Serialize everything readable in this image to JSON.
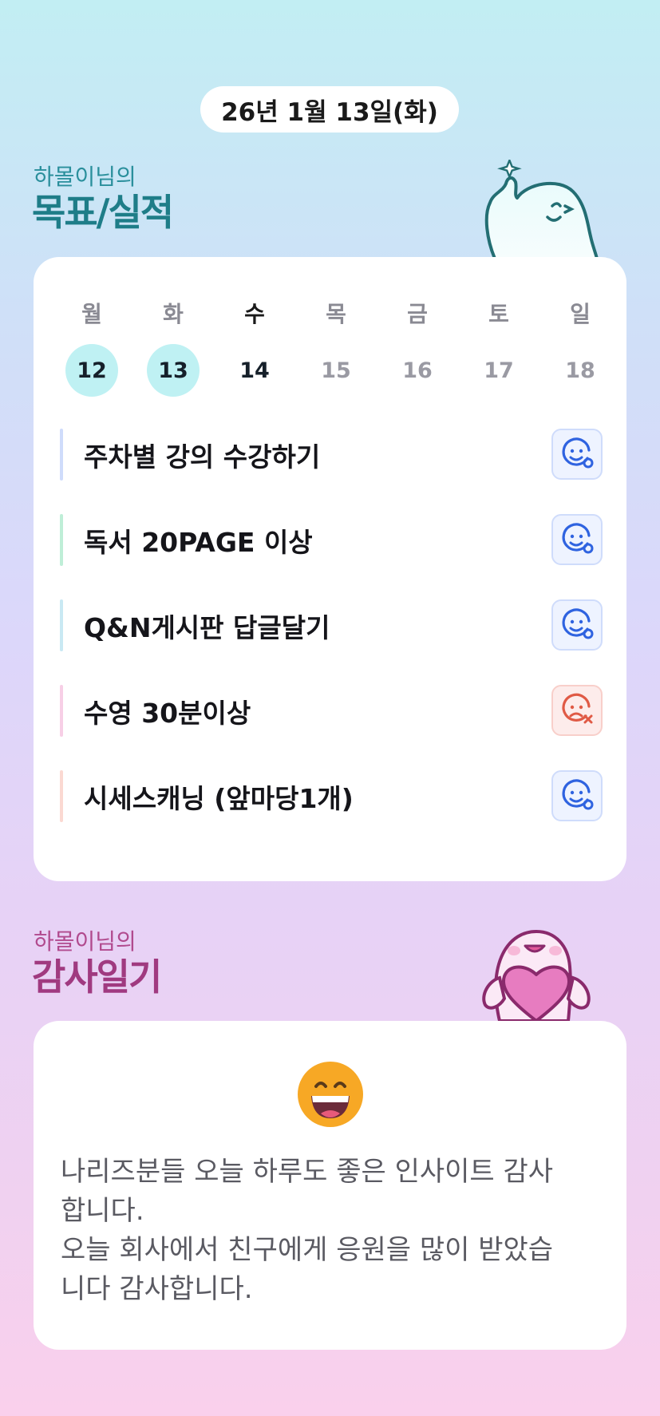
{
  "date": "26년 1월 13일(화)",
  "goal_section": {
    "subtitle": "하몰이님의",
    "title": "목표/실적"
  },
  "week": [
    {
      "day": "월",
      "date": "12",
      "state": "done"
    },
    {
      "day": "화",
      "date": "13",
      "state": "done"
    },
    {
      "day": "수",
      "date": "14",
      "state": "today"
    },
    {
      "day": "목",
      "date": "15",
      "state": "future"
    },
    {
      "day": "금",
      "date": "16",
      "state": "future"
    },
    {
      "day": "토",
      "date": "17",
      "state": "future"
    },
    {
      "day": "일",
      "date": "18",
      "state": "future"
    }
  ],
  "goals": [
    {
      "text": "주차별 강의 수강하기",
      "accent": "#cfdcfb",
      "status": "achieved",
      "icon": "happy-face-icon"
    },
    {
      "text": "독서 20PAGE 이상",
      "accent": "#bfeed7",
      "status": "achieved",
      "icon": "happy-face-icon"
    },
    {
      "text": "Q&N게시판 답글달기",
      "accent": "#c9e9f3",
      "status": "achieved",
      "icon": "happy-face-icon"
    },
    {
      "text": "수영 30분이상",
      "accent": "#f7cfe6",
      "status": "failed",
      "icon": "sad-face-icon"
    },
    {
      "text": "시세스캐닝 (앞마당1개)",
      "accent": "#fbd9d2",
      "status": "achieved",
      "icon": "happy-face-icon"
    }
  ],
  "gratitude_section": {
    "subtitle": "하몰이님의",
    "title": "감사일기"
  },
  "gratitude": {
    "emoji": "grinning-face-icon",
    "lines": [
      "나리즈분들 오늘 하루도 좋은 인사이트 감사",
      "합니다.",
      "오늘 회사에서 친구에게 응원을 많이 받았습",
      "니다 감사합니다."
    ]
  },
  "colors": {
    "goal_title": "#1e7d88",
    "gratitude_title": "#a03a80",
    "achieved_icon": "#2f63e0",
    "failed_icon": "#e05a45",
    "done_day_bg": "#bff1f3"
  }
}
